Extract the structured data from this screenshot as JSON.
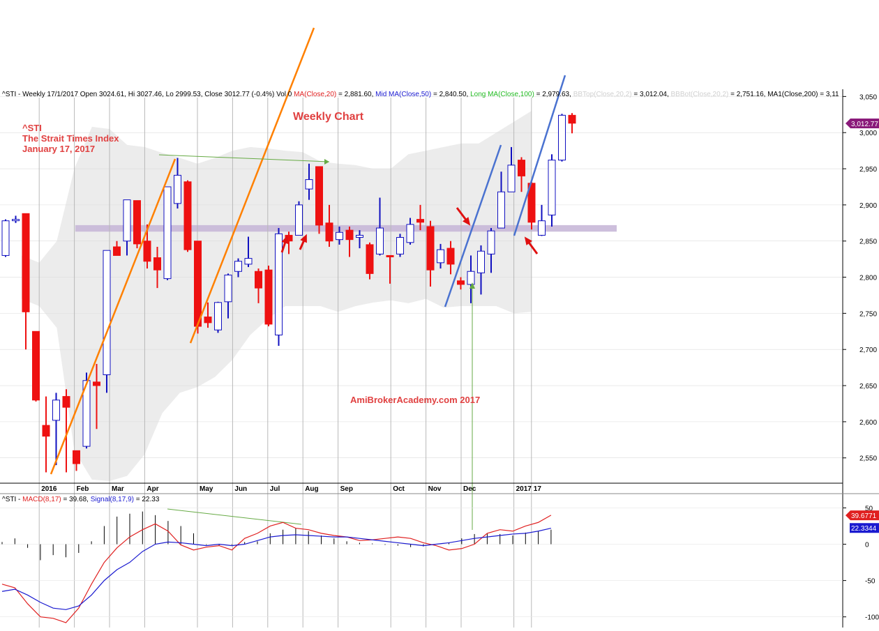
{
  "header": {
    "price_parts": [
      {
        "text": "^STI - Weekly 17/1/2017 Open 3024.61, Hi 3027.46, Lo 2999.53, Close 3012.77 (-0.4%) Vol 0 ",
        "color": "#000000"
      },
      {
        "text": "MA(Close,20)",
        "color": "#e02020"
      },
      {
        "text": " = 2,881.60, ",
        "color": "#000000"
      },
      {
        "text": "Mid MA(Close,50)",
        "color": "#1a1ad0"
      },
      {
        "text": " = 2,840.50, ",
        "color": "#000000"
      },
      {
        "text": "Long MA(Close,100)",
        "color": "#22bb22"
      },
      {
        "text": " = 2,979.63, ",
        "color": "#000000"
      },
      {
        "text": "BBTop(Close,20,2)",
        "color": "#d0d0d0"
      },
      {
        "text": " = 3,012.04, ",
        "color": "#000000"
      },
      {
        "text": "BBBot(Close,20,2)",
        "color": "#d0d0d0"
      },
      {
        "text": " = 2,751.16, MA1(Close,200) = 3,11",
        "color": "#000000"
      }
    ],
    "macd_parts": [
      {
        "text": "^STI - ",
        "color": "#000000"
      },
      {
        "text": "MACD(8,17)",
        "color": "#e02020"
      },
      {
        "text": " = 39.68, ",
        "color": "#000000"
      },
      {
        "text": "Signal(8,17,9)",
        "color": "#1a1ad0"
      },
      {
        "text": " = 22.33",
        "color": "#000000"
      }
    ]
  },
  "annotations": {
    "symbol": "^STI",
    "index_name": "The Strait Times Index",
    "date": "January 17, 2017",
    "chart_title": "Weekly Chart",
    "watermark": "AmiBrokerAcademy.com  2017"
  },
  "colors": {
    "up_candle": "#ffffff",
    "up_outline": "#1010c0",
    "down_candle": "#ee1111",
    "bb_band": "#ececec",
    "support_zone": "#c8b8d8",
    "orange_trend": "#ff8000",
    "blue_trend": "#4a72d0",
    "macd": "#e02020",
    "signal": "#1a1ad0",
    "annotation_text": "#e04040"
  },
  "chart_data": [
    {
      "type": "candlestick",
      "title": "Weekly Chart",
      "ylim": [
        2515,
        3060
      ],
      "yticks": [
        3050,
        3000,
        2950,
        2900,
        2850,
        2800,
        2750,
        2700,
        2650,
        2600,
        2550
      ],
      "ytick_labels": [
        "3,050",
        "3,000",
        "2,950",
        "2,900",
        "2,850",
        "2,800",
        "2,750",
        "2,700",
        "2,650",
        "2,600",
        "2,550"
      ],
      "x_labels": [
        "2016",
        "Feb",
        "Mar",
        "Apr",
        "May",
        "Jun",
        "Jul",
        "Aug",
        "Sep",
        "Oct",
        "Nov",
        "Dec",
        "2017",
        "17"
      ],
      "x_label_index": [
        1,
        3,
        5,
        7,
        10,
        12,
        14,
        16,
        18,
        21,
        23,
        25,
        28,
        29
      ],
      "last_close_label": "3,012.77",
      "candles": [
        {
          "o": 2830,
          "h": 2880,
          "l": 2828,
          "c": 2878
        },
        {
          "o": 2880,
          "h": 2885,
          "l": 2875,
          "c": 2880
        },
        {
          "o": 2888,
          "h": 2888,
          "l": 2700,
          "c": 2752
        },
        {
          "o": 2725,
          "h": 2725,
          "l": 2628,
          "c": 2630
        },
        {
          "o": 2595,
          "h": 2635,
          "l": 2530,
          "c": 2580
        },
        {
          "o": 2602,
          "h": 2640,
          "l": 2540,
          "c": 2630
        },
        {
          "o": 2635,
          "h": 2645,
          "l": 2530,
          "c": 2620
        },
        {
          "o": 2560,
          "h": 2560,
          "l": 2532,
          "c": 2542
        },
        {
          "o": 2566,
          "h": 2668,
          "l": 2563,
          "c": 2657
        },
        {
          "o": 2655,
          "h": 2680,
          "l": 2590,
          "c": 2650
        },
        {
          "o": 2665,
          "h": 2837,
          "l": 2640,
          "c": 2837
        },
        {
          "o": 2842,
          "h": 2850,
          "l": 2830,
          "c": 2830
        },
        {
          "o": 2850,
          "h": 2907,
          "l": 2830,
          "c": 2907
        },
        {
          "o": 2906,
          "h": 2906,
          "l": 2840,
          "c": 2846
        },
        {
          "o": 2850,
          "h": 2873,
          "l": 2812,
          "c": 2822
        },
        {
          "o": 2827,
          "h": 2842,
          "l": 2785,
          "c": 2810
        },
        {
          "o": 2798,
          "h": 2925,
          "l": 2796,
          "c": 2925
        },
        {
          "o": 2902,
          "h": 2965,
          "l": 2895,
          "c": 2941
        },
        {
          "o": 2932,
          "h": 2934,
          "l": 2835,
          "c": 2838
        },
        {
          "o": 2850,
          "h": 2850,
          "l": 2722,
          "c": 2732
        },
        {
          "o": 2745,
          "h": 2765,
          "l": 2730,
          "c": 2737
        },
        {
          "o": 2727,
          "h": 2766,
          "l": 2723,
          "c": 2765
        },
        {
          "o": 2766,
          "h": 2805,
          "l": 2743,
          "c": 2803
        },
        {
          "o": 2808,
          "h": 2826,
          "l": 2800,
          "c": 2822
        },
        {
          "o": 2818,
          "h": 2856,
          "l": 2814,
          "c": 2826
        },
        {
          "o": 2808,
          "h": 2812,
          "l": 2764,
          "c": 2785
        },
        {
          "o": 2810,
          "h": 2816,
          "l": 2732,
          "c": 2735
        },
        {
          "o": 2720,
          "h": 2868,
          "l": 2705,
          "c": 2860
        },
        {
          "o": 2858,
          "h": 2863,
          "l": 2832,
          "c": 2850
        },
        {
          "o": 2858,
          "h": 2905,
          "l": 2860,
          "c": 2900
        },
        {
          "o": 2922,
          "h": 2957,
          "l": 2907,
          "c": 2935
        },
        {
          "o": 2953,
          "h": 2953,
          "l": 2860,
          "c": 2872
        },
        {
          "o": 2875,
          "h": 2900,
          "l": 2842,
          "c": 2850
        },
        {
          "o": 2852,
          "h": 2870,
          "l": 2845,
          "c": 2862
        },
        {
          "o": 2865,
          "h": 2870,
          "l": 2828,
          "c": 2852
        },
        {
          "o": 2855,
          "h": 2865,
          "l": 2840,
          "c": 2858
        },
        {
          "o": 2845,
          "h": 2848,
          "l": 2797,
          "c": 2805
        },
        {
          "o": 2832,
          "h": 2910,
          "l": 2830,
          "c": 2868
        },
        {
          "o": 2830,
          "h": 2830,
          "l": 2791,
          "c": 2829
        },
        {
          "o": 2832,
          "h": 2860,
          "l": 2828,
          "c": 2855
        },
        {
          "o": 2848,
          "h": 2882,
          "l": 2845,
          "c": 2873
        },
        {
          "o": 2880,
          "h": 2900,
          "l": 2865,
          "c": 2876
        },
        {
          "o": 2870,
          "h": 2878,
          "l": 2787,
          "c": 2810
        },
        {
          "o": 2820,
          "h": 2846,
          "l": 2812,
          "c": 2838
        },
        {
          "o": 2840,
          "h": 2850,
          "l": 2804,
          "c": 2818
        },
        {
          "o": 2795,
          "h": 2800,
          "l": 2783,
          "c": 2790
        },
        {
          "o": 2790,
          "h": 2830,
          "l": 2764,
          "c": 2808
        },
        {
          "o": 2806,
          "h": 2844,
          "l": 2776,
          "c": 2836
        },
        {
          "o": 2832,
          "h": 2868,
          "l": 2806,
          "c": 2864
        },
        {
          "o": 2868,
          "h": 2946,
          "l": 2868,
          "c": 2918
        },
        {
          "o": 2918,
          "h": 2980,
          "l": 2918,
          "c": 2955
        },
        {
          "o": 2962,
          "h": 2966,
          "l": 2918,
          "c": 2940
        },
        {
          "o": 2930,
          "h": 2932,
          "l": 2866,
          "c": 2876
        },
        {
          "o": 2858,
          "h": 2900,
          "l": 2857,
          "c": 2878
        },
        {
          "o": 2886,
          "h": 2970,
          "l": 2870,
          "c": 2962
        },
        {
          "o": 2962,
          "h": 3026,
          "l": 2960,
          "c": 3024
        },
        {
          "o": 3024,
          "h": 3027,
          "l": 2999,
          "c": 3013
        }
      ],
      "bb_upper": [
        2830,
        2820,
        2850,
        2950,
        3008,
        3005,
        2983,
        2980,
        2972,
        2965,
        2957,
        2965,
        2975,
        2980,
        2978,
        2975,
        2973,
        2960,
        2957,
        2955,
        2950,
        2950,
        2970,
        2975,
        2980,
        2985,
        2985,
        3000,
        3015,
        3030
      ],
      "bb_lower": [
        2770,
        2760,
        2730,
        2560,
        2520,
        2518,
        2525,
        2555,
        2612,
        2640,
        2648,
        2662,
        2686,
        2720,
        2742,
        2760,
        2760,
        2760,
        2752,
        2760,
        2765,
        2768,
        2764,
        2770,
        2758,
        2760,
        2760,
        2760,
        2750,
        2752
      ],
      "support_zone": [
        2863,
        2872
      ],
      "x_span_weeks": [
        0,
        30
      ]
    },
    {
      "type": "line",
      "title": "MACD(8,17)",
      "ylim": [
        -107,
        60
      ],
      "yticks": [
        50,
        0,
        -50,
        -100
      ],
      "ytick_labels": [
        "50",
        "0",
        "-50",
        "-100"
      ],
      "macd_label": "39.6771",
      "signal_label": "22.3344",
      "series": [
        {
          "name": "MACD(8,17)",
          "values": [
            -55,
            -60,
            -82,
            -100,
            -102,
            -108,
            -88,
            -55,
            -25,
            -5,
            10,
            20,
            28,
            18,
            -1,
            -8,
            -4,
            -2,
            -8,
            8,
            15,
            25,
            30,
            22,
            20,
            15,
            12,
            10,
            5,
            6,
            8,
            10,
            8,
            2,
            -2,
            -8,
            -6,
            0,
            15,
            20,
            18,
            25,
            30,
            40
          ]
        },
        {
          "name": "Signal(8,17,9)",
          "values": [
            -65,
            -62,
            -70,
            -80,
            -88,
            -90,
            -85,
            -70,
            -50,
            -35,
            -25,
            -10,
            0,
            3,
            2,
            0,
            -2,
            0,
            -2,
            0,
            5,
            10,
            12,
            13,
            12,
            11,
            10,
            10,
            8,
            6,
            4,
            2,
            0,
            -2,
            0,
            2,
            5,
            8,
            10,
            12,
            14,
            15,
            18,
            22
          ]
        }
      ],
      "histogram": [
        3,
        8,
        -5,
        -22,
        -15,
        -18,
        -12,
        4,
        25,
        38,
        42,
        45,
        40,
        32,
        25,
        15,
        -1,
        -2,
        -1,
        3,
        4,
        15,
        20,
        22,
        18,
        12,
        8,
        4,
        2,
        1,
        -1,
        -2,
        -4,
        -3,
        0,
        2,
        8,
        14,
        15,
        14,
        12,
        16,
        18,
        20
      ]
    }
  ]
}
